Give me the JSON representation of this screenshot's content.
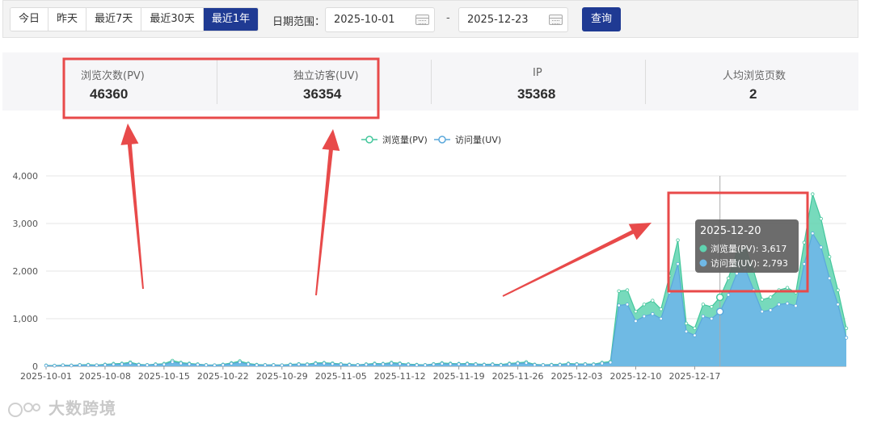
{
  "toolbar": {
    "ranges": [
      {
        "label": "今日"
      },
      {
        "label": "昨天"
      },
      {
        "label": "最近7天"
      },
      {
        "label": "最近30天"
      },
      {
        "label": "最近1年"
      }
    ],
    "active_range": 4,
    "date_range_label": "日期范围：",
    "start_date": "2025-10-01",
    "end_date": "2025-12-23",
    "separator": "-",
    "query_label": "查询"
  },
  "stats": [
    {
      "label": "浏览次数(PV)",
      "value": "46360"
    },
    {
      "label": "独立访客(UV)",
      "value": "36354"
    },
    {
      "label": "IP",
      "value": "35368"
    },
    {
      "label": "人均浏览页数",
      "value": "2"
    }
  ],
  "colors": {
    "accent": "#1f3a93",
    "pv": "#5fd3b0",
    "uv": "#6fb8e6",
    "annotation": "#e84a4a"
  },
  "chart_data": {
    "type": "area",
    "x_tick_labels": [
      "2025-10-01",
      "2025-10-08",
      "2025-10-15",
      "2025-10-22",
      "2025-10-29",
      "2025-11-05",
      "2025-11-12",
      "2025-11-19",
      "2025-11-26",
      "2025-12-03",
      "2025-12-10",
      "2025-12-17"
    ],
    "ylim": [
      0,
      4000
    ],
    "y_ticks": [
      "0",
      "1,000",
      "2,000",
      "3,000",
      "4,000"
    ],
    "grid": true,
    "legend_position": "top-center",
    "legend": [
      "浏览量(PV)",
      "访问量(UV)"
    ],
    "x_start": "2025-10-01",
    "x_end": "2025-12-23",
    "series": [
      {
        "name": "浏览量(PV)",
        "values": [
          20,
          15,
          25,
          20,
          30,
          35,
          25,
          40,
          55,
          60,
          85,
          40,
          30,
          45,
          55,
          120,
          80,
          60,
          45,
          30,
          25,
          40,
          70,
          110,
          60,
          35,
          30,
          30,
          25,
          40,
          50,
          45,
          70,
          75,
          65,
          50,
          40,
          30,
          45,
          60,
          55,
          80,
          65,
          45,
          35,
          30,
          50,
          70,
          60,
          55,
          60,
          50,
          40,
          45,
          35,
          60,
          75,
          90,
          40,
          30,
          35,
          40,
          60,
          50,
          50,
          45,
          80,
          100,
          1580,
          1600,
          1150,
          1300,
          1380,
          1200,
          1900,
          2650,
          900,
          800,
          1300,
          1250,
          1450,
          1850,
          2400,
          2500,
          2000,
          1400,
          1450,
          1600,
          1650,
          1550,
          2600,
          3617,
          3100,
          2300,
          1600,
          800
        ]
      },
      {
        "name": "访问量(UV)",
        "values": [
          15,
          12,
          20,
          15,
          25,
          25,
          20,
          30,
          40,
          45,
          65,
          30,
          25,
          35,
          40,
          90,
          60,
          45,
          35,
          25,
          20,
          30,
          55,
          85,
          45,
          25,
          25,
          25,
          20,
          30,
          40,
          35,
          55,
          60,
          50,
          40,
          30,
          25,
          35,
          45,
          45,
          60,
          50,
          35,
          25,
          25,
          40,
          55,
          45,
          45,
          45,
          40,
          30,
          35,
          25,
          45,
          60,
          70,
          30,
          25,
          25,
          30,
          45,
          40,
          40,
          35,
          60,
          80,
          1280,
          1300,
          950,
          1050,
          1100,
          1000,
          1550,
          2150,
          730,
          650,
          1050,
          1000,
          1150,
          1500,
          1950,
          2050,
          1600,
          1150,
          1180,
          1300,
          1320,
          1270,
          2150,
          2793,
          2500,
          1850,
          1300,
          600
        ]
      }
    ],
    "tooltip": {
      "date": "2025-12-20",
      "rows": [
        "浏览量(PV): 3,617",
        "访问量(UV): 2,793"
      ]
    }
  },
  "watermark": "大数跨境"
}
